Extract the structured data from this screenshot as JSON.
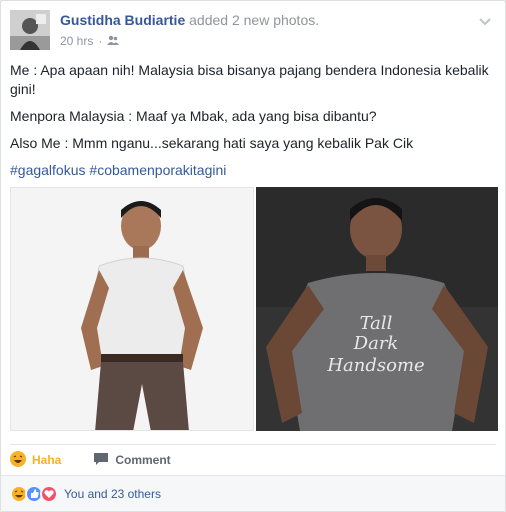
{
  "post": {
    "author": "Gustidha Budiartie",
    "action_text": " added ",
    "action_link": "2 new photos",
    "action_end": ".",
    "time": "20 hrs",
    "lines": [
      "Me : Apa apaan nih! Malaysia bisa bisanya pajang bendera Indonesia kebalik gini!",
      "Menpora Malaysia : Maaf ya Mbak, ada yang bisa dibantu?",
      "Also Me : Mmm nganu...sekarang hati saya yang kebalik Pak Cik"
    ],
    "hashtags": [
      "#gagalfokus",
      "#cobamenporakitagini"
    ]
  },
  "photos": {
    "right_shirt_text": [
      "Tall",
      "Dark",
      "Handsome"
    ]
  },
  "actions": {
    "haha_label": "Haha",
    "comment_label": "Comment"
  },
  "reactions": {
    "summary": "You and 23 others"
  },
  "colors": {
    "link": "#365899",
    "haha": "#f7b125",
    "like": "#5890ff",
    "love": "#f25268"
  }
}
